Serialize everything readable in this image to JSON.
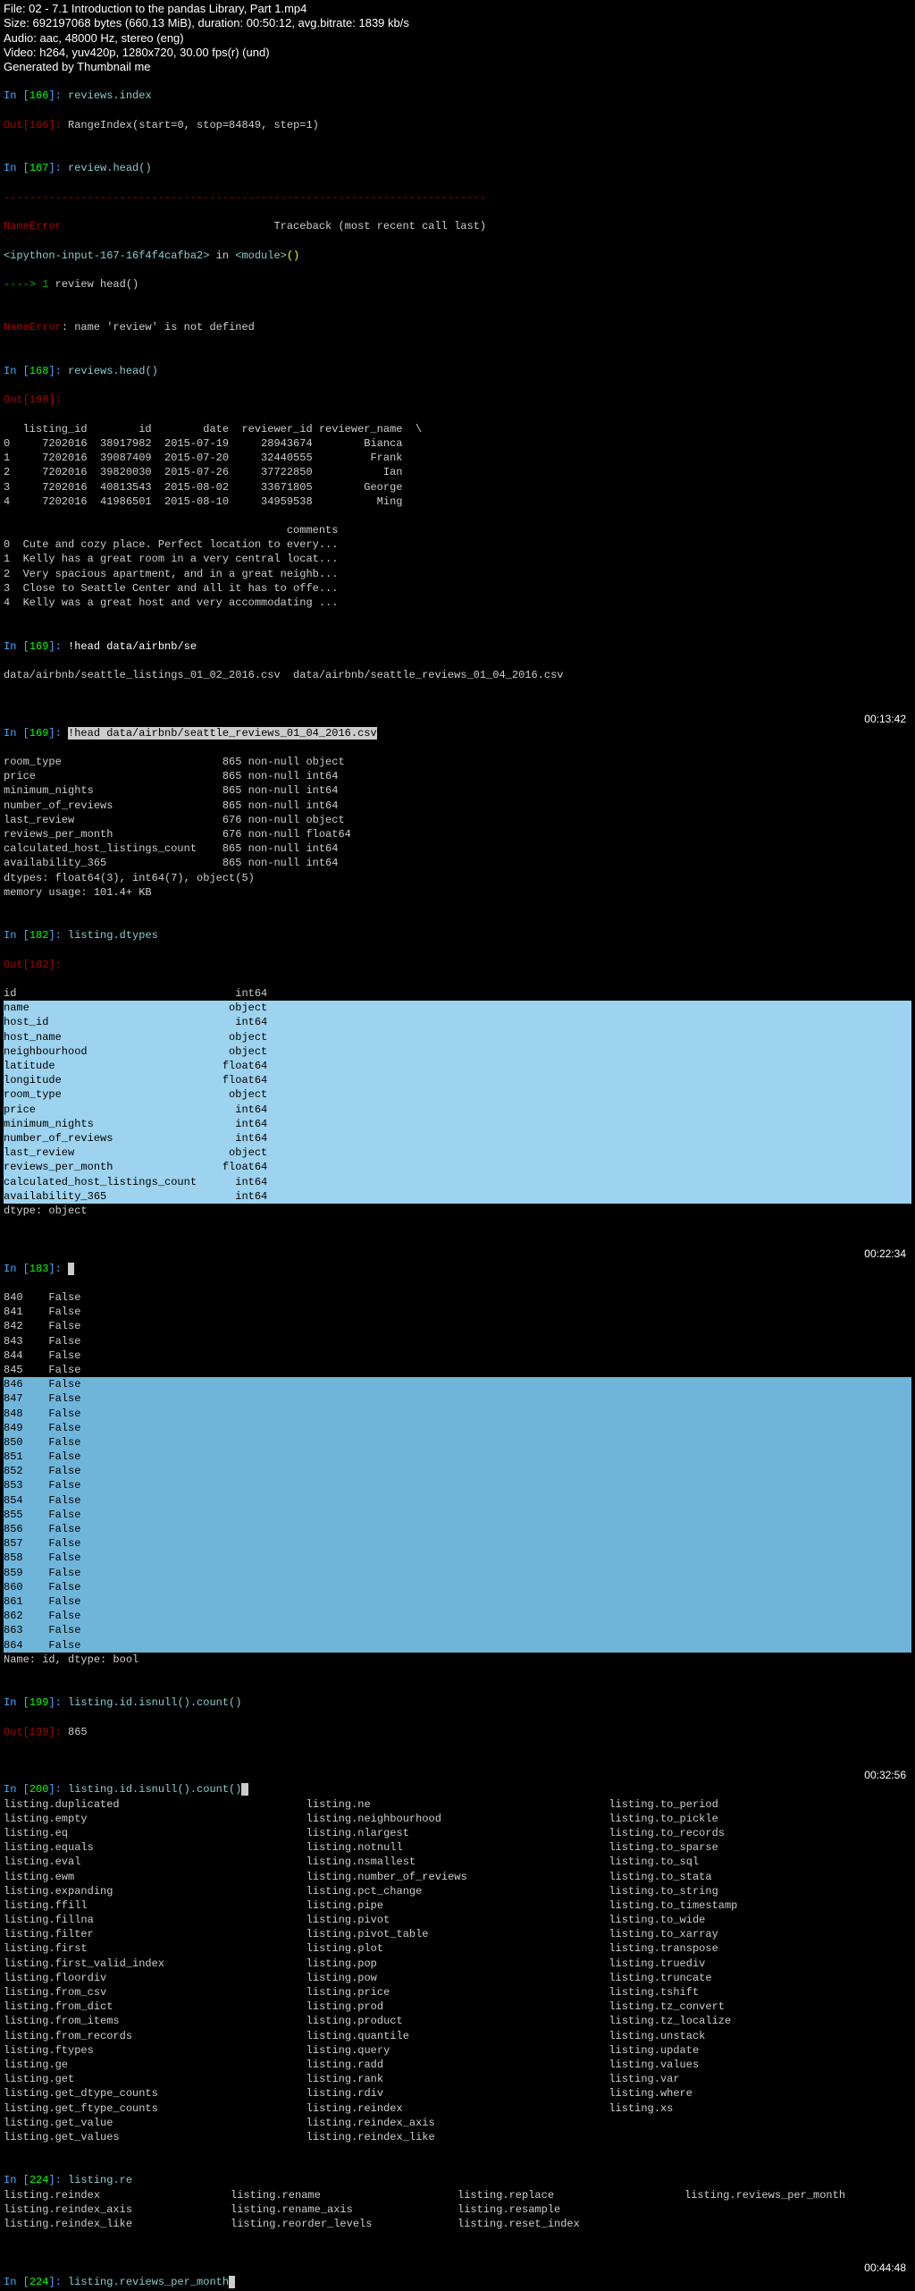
{
  "header": {
    "file": "File: 02 - 7.1 Introduction to the pandas Library, Part 1.mp4",
    "size": "Size: 692197068 bytes (660.13 MiB), duration: 00:50:12, avg.bitrate: 1839 kb/s",
    "audio": "Audio: aac, 48000 Hz, stereo (eng)",
    "video": "Video: h264, yuv420p, 1280x720, 30.00 fps(r) (und)",
    "gen": "Generated by Thumbnail me"
  },
  "cells": {
    "c166": {
      "in": "In [",
      "num": "166",
      "close": "]: ",
      "code": "reviews.index",
      "outp": "Out[",
      "outnum": "166",
      "outclose": "]: ",
      "outval": "RangeIndex(start=0, stop=84849, step=1)"
    },
    "c167": {
      "in": "In [",
      "num": "167",
      "close": "]: ",
      "code": "review.head()",
      "dash": "---------------------------------------------------------------------------",
      "err1": "NameError",
      "tb": "                                 Traceback (most recent call last)",
      "mod1": "<ipython-input-167-16f4f4cafba2>",
      "inword": " in ",
      "mod2": "<module>",
      "paren": "()",
      "arrow": "----> ",
      "one": "1",
      "line": " review head()",
      "err2": "NameError",
      "errmsg": ": name 'review' is not defined"
    },
    "c168": {
      "in": "In [",
      "num": "168",
      "close": "]: ",
      "code": "reviews.head()",
      "outp": "Out[",
      "outnum": "168",
      "outclose": "]: ",
      "table": "   listing_id        id        date  reviewer_id reviewer_name  \\\n0     7202016  38917982  2015-07-19     28943674        Bianca\n1     7202016  39087409  2015-07-20     32440555         Frank\n2     7202016  39820030  2015-07-26     37722850           Ian\n3     7202016  40813543  2015-08-02     33671805        George\n4     7202016  41986501  2015-08-10     34959538          Ming\n\n                                            comments\n0  Cute and cozy place. Perfect location to every...\n1  Kelly has a great room in a very central locat...\n2  Very spacious apartment, and in a great neighb...\n3  Close to Seattle Center and all it has to offe...\n4  Kelly was a great host and very accommodating ..."
    },
    "c169a": {
      "in": "In [",
      "num": "169",
      "close": "]: ",
      "code": "!head data/airbnb/se",
      "out": "data/airbnb/seattle_listings_01_02_2016.csv  data/airbnb/seattle_reviews_01_04_2016.csv"
    },
    "c169b": {
      "in": "In [",
      "num": "169",
      "close": "]: ",
      "cmd": "!head data/airbnb/seattle_reviews_01_04_2016.csv",
      "ts": "00:13:42",
      "out": "room_type                         865 non-null object\nprice                             865 non-null int64\nminimum_nights                    865 non-null int64\nnumber_of_reviews                 865 non-null int64\nlast_review                       676 non-null object\nreviews_per_month                 676 non-null float64\ncalculated_host_listings_count    865 non-null int64\navailability_365                  865 non-null int64\ndtypes: float64(3), int64(7), object(5)\nmemory usage: 101.4+ KB"
    },
    "c182": {
      "in": "In [",
      "num": "182",
      "close": "]: ",
      "code": "listing.dtypes",
      "outp": "Out[",
      "outnum": "182",
      "outclose": "]: ",
      "line1": "id                                  int64",
      "sel": "name                               object\nhost_id                             int64\nhost_name                          object\nneighbourhood                      object\nlatitude                          float64\nlongitude                         float64\nroom_type                          object\nprice                               int64\nminimum_nights                      int64\nnumber_of_reviews                   int64\nlast_review                        object\nreviews_per_month                 float64\ncalculated_host_listings_count      int64\navailability_365                    int64",
      "tail": "dtype: object"
    },
    "c183": {
      "in": "In [",
      "num": "183",
      "close": "]: ",
      "ts": "00:22:34",
      "pre": "840    False\n841    False\n842    False\n843    False\n844    False\n845    False",
      "sel": "846    False\n847    False\n848    False\n849    False\n850    False\n851    False\n852    False\n853    False\n854    False\n855    False\n856    False\n857    False\n858    False\n859    False\n860    False\n861    False\n862    False\n863    False\n864    False",
      "tail": "Name: id, dtype: bool"
    },
    "c199": {
      "in": "In [",
      "num": "199",
      "close": "]: ",
      "code": "listing.id.isnull().count()",
      "outp": "Out[",
      "outnum": "199",
      "outclose": "]: ",
      "outval": "865"
    },
    "c200": {
      "in": "In [",
      "num": "200",
      "close": "]: ",
      "code": "listing.id.isnull().count()",
      "ts": "00:32:56",
      "col1": [
        "listing.duplicated",
        "listing.empty",
        "listing.eq",
        "listing.equals",
        "listing.eval",
        "listing.ewm",
        "listing.expanding",
        "listing.ffill",
        "listing.fillna",
        "listing.filter",
        "listing.first",
        "listing.first_valid_index",
        "listing.floordiv",
        "listing.from_csv",
        "listing.from_dict",
        "listing.from_items",
        "listing.from_records",
        "listing.ftypes",
        "listing.ge",
        "listing.get",
        "listing.get_dtype_counts",
        "listing.get_ftype_counts",
        "listing.get_value",
        "listing.get_values"
      ],
      "col2": [
        "listing.ne",
        "listing.neighbourhood",
        "listing.nlargest",
        "listing.notnull",
        "listing.nsmallest",
        "listing.number_of_reviews",
        "listing.pct_change",
        "listing.pipe",
        "listing.pivot",
        "listing.pivot_table",
        "listing.plot",
        "listing.pop",
        "listing.pow",
        "listing.price",
        "listing.prod",
        "listing.product",
        "listing.quantile",
        "listing.query",
        "listing.radd",
        "listing.rank",
        "listing.rdiv",
        "listing.reindex",
        "listing.reindex_axis",
        "listing.reindex_like"
      ],
      "col3": [
        "listing.to_period",
        "listing.to_pickle",
        "listing.to_records",
        "listing.to_sparse",
        "listing.to_sql",
        "listing.to_stata",
        "listing.to_string",
        "listing.to_timestamp",
        "listing.to_wide",
        "listing.to_xarray",
        "listing.transpose",
        "listing.truediv",
        "listing.truncate",
        "listing.tshift",
        "listing.tz_convert",
        "listing.tz_localize",
        "listing.unstack",
        "listing.update",
        "listing.values",
        "listing.var",
        "listing.where",
        "listing.xs",
        "",
        ""
      ]
    },
    "c224a": {
      "in": "In [",
      "num": "224",
      "close": "]: ",
      "code": "listing.re",
      "col1": [
        "listing.reindex",
        "listing.reindex_axis",
        "listing.reindex_like"
      ],
      "col2": [
        "listing.rename",
        "listing.rename_axis",
        "listing.reorder_levels"
      ],
      "col3": [
        "listing.replace",
        "listing.resample",
        "listing.reset_index"
      ],
      "col4": [
        "listing.reviews_per_month",
        "",
        ""
      ]
    },
    "c224b": {
      "in": "In [",
      "num": "224",
      "close": "]: ",
      "code": "listing.reviews_per_month",
      "ts": "00:44:48"
    }
  }
}
